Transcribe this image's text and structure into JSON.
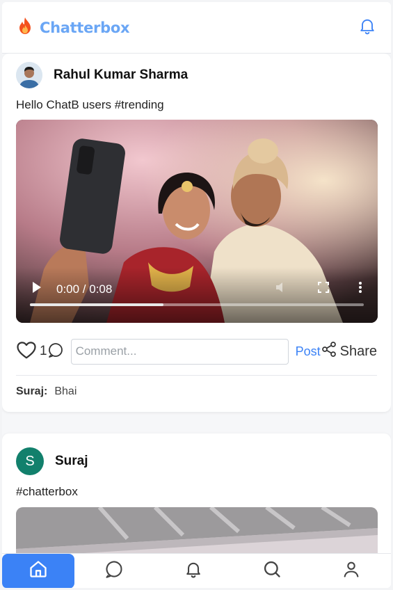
{
  "header": {
    "app_name": "Chatterbox",
    "logo_icon": "flame-icon",
    "notifications_icon": "bell-icon",
    "accent_color": "#6aa6f5"
  },
  "posts": [
    {
      "author": "Rahul Kumar Sharma",
      "avatar": "profile-photo",
      "text": "Hello ChatB users #trending",
      "media": {
        "type": "video",
        "time_label": "0:00 / 0:08",
        "progress_fraction": 0.4
      },
      "likes": "1",
      "comment_placeholder": "Comment...",
      "post_label": "Post",
      "share_label": "Share",
      "comments": [
        {
          "user": "Suraj:",
          "text": "Bhai"
        }
      ]
    },
    {
      "author": "Suraj",
      "avatar_letter": "S",
      "avatar_color": "#12806c",
      "text": "#chatterbox",
      "media": {
        "type": "image"
      }
    }
  ],
  "bottom_nav": {
    "items": [
      "home-icon",
      "chat-icon",
      "bell-icon",
      "search-icon",
      "user-icon"
    ],
    "active": "home-icon",
    "active_color": "#3b82f6"
  }
}
